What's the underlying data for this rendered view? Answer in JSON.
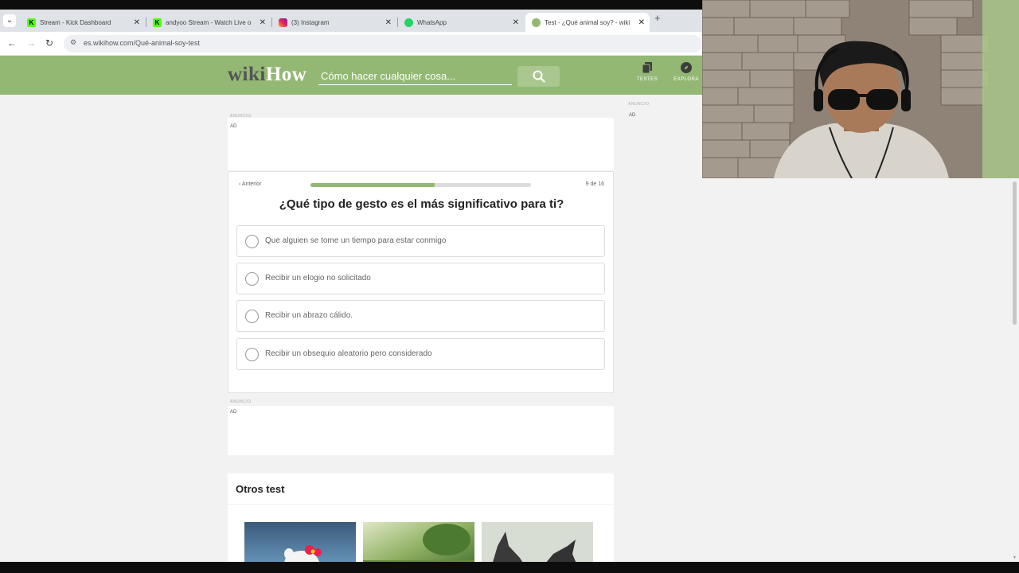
{
  "browser": {
    "tabs": [
      {
        "title": "Stream - Kick Dashboard",
        "favicon": "kick-icon",
        "active": false
      },
      {
        "title": "andyoo Stream - Watch Live o",
        "favicon": "kick-icon",
        "active": false
      },
      {
        "title": "(3) Instagram",
        "favicon": "instagram-icon",
        "active": false
      },
      {
        "title": "WhatsApp",
        "favicon": "whatsapp-icon",
        "active": false
      },
      {
        "title": "Test - ¿Qué animal soy? - wiki",
        "favicon": "wikihow-icon",
        "active": true
      }
    ],
    "new_tab": "+",
    "url": "es.wikihow.com/Qué-animal-soy-test"
  },
  "header": {
    "logo_wiki": "wiki",
    "logo_how": "How",
    "search_placeholder": "Cómo hacer cualquier cosa...",
    "nav": [
      {
        "label": "TESTES",
        "icon": "quiz-icon"
      },
      {
        "label": "EXPLORA",
        "icon": "compass-icon"
      }
    ],
    "brand_color": "#93b874"
  },
  "ads": {
    "label": "ANUNCIO",
    "tag": "AD"
  },
  "quiz": {
    "back_label": "‹ Anterior",
    "counter": "9 de 16",
    "progress": 0.5625,
    "question": "¿Qué tipo de gesto es el más significativo para ti?",
    "options": [
      "Que alguien se tome un tiempo para estar conmigo",
      "Recibir un elogio no solicitado",
      "Recibir un abrazo cálido.",
      "Recibir un obsequio aleatorio pero considerado"
    ]
  },
  "others": {
    "title": "Otros test"
  }
}
